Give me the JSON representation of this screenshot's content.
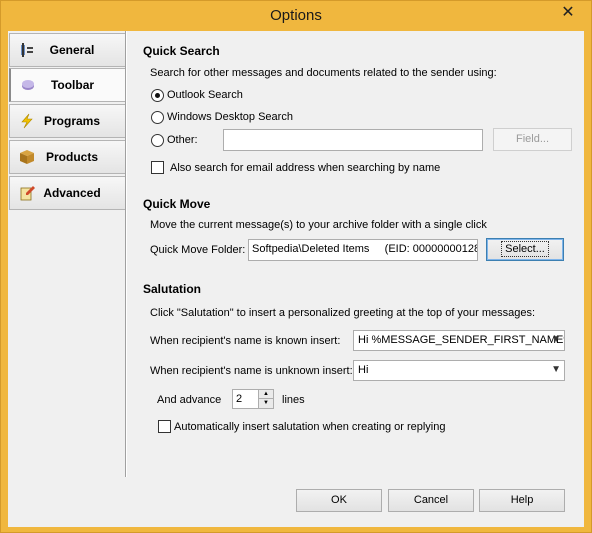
{
  "window": {
    "title": "Options",
    "close_glyph": "✕"
  },
  "sidebar": {
    "items": [
      {
        "label": "General",
        "icon": "general-icon",
        "active": false
      },
      {
        "label": "Toolbar",
        "icon": "toolbar-icon",
        "active": true
      },
      {
        "label": "Programs",
        "icon": "lightning-icon",
        "active": false
      },
      {
        "label": "Products",
        "icon": "box-icon",
        "active": false
      },
      {
        "label": "Advanced",
        "icon": "pencil-icon",
        "active": false
      }
    ]
  },
  "quick_search": {
    "title": "Quick Search",
    "description": "Search for other messages and documents related to the sender using:",
    "options": [
      {
        "label": "Outlook Search",
        "selected": true
      },
      {
        "label": "Windows Desktop Search",
        "selected": false
      },
      {
        "label": "Other:",
        "selected": false
      }
    ],
    "other_value": "",
    "field_button": "Field...",
    "email_check_label": "Also search for email address when searching by name",
    "email_check_checked": false
  },
  "quick_move": {
    "title": "Quick Move",
    "description": "Move the current message(s) to your archive folder with a single click",
    "folder_label": "Quick Move Folder:",
    "folder_value": "Softpedia\\Deleted Items     (EID: 00000000128",
    "select_button": "Select..."
  },
  "salutation": {
    "title": "Salutation",
    "description": "Click \"Salutation\" to insert a personalized greeting at the top of your messages:",
    "known_label": "When recipient's name is known insert:",
    "known_value": "Hi %MESSAGE_SENDER_FIRST_NAME%",
    "unknown_label": "When recipient's name is unknown insert:",
    "unknown_value": "Hi",
    "advance_label": "And advance",
    "advance_value": "2",
    "lines_label": "lines",
    "auto_label": "Automatically insert salutation when creating or replying",
    "auto_checked": false
  },
  "footer": {
    "ok": "OK",
    "cancel": "Cancel",
    "help": "Help"
  }
}
